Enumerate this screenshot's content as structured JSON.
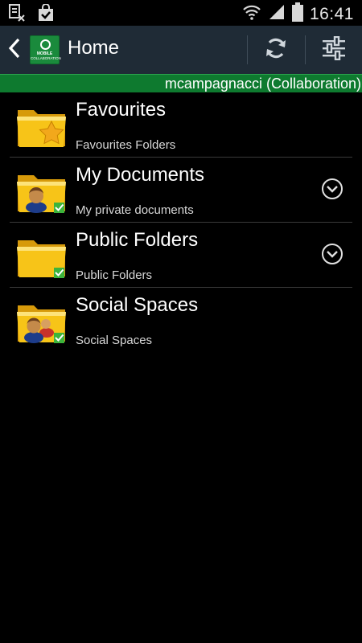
{
  "status_bar": {
    "time": "16:41",
    "icons": [
      "sim-error-icon",
      "shopping-bag-icon",
      "wifi-icon",
      "signal-icon",
      "battery-icon"
    ]
  },
  "action_bar": {
    "title": "Home",
    "logo_text_line1": "MOBILE",
    "logo_text_line2": "COLLABORATION",
    "back_icon": "chevron-left-icon",
    "refresh_icon": "refresh-icon",
    "settings_icon": "sliders-icon"
  },
  "user_banner": {
    "text": "mcampagnacci (Collaboration)"
  },
  "list": {
    "items": [
      {
        "title": "Favourites",
        "subtitle": "Favourites Folders",
        "icon": "folder-star-icon",
        "expandable": false
      },
      {
        "title": "My Documents",
        "subtitle": "My private documents",
        "icon": "folder-user-icon",
        "expandable": true
      },
      {
        "title": "Public Folders",
        "subtitle": "Public Folders",
        "icon": "folder-shared-icon",
        "expandable": true
      },
      {
        "title": "Social Spaces",
        "subtitle": "Social Spaces",
        "icon": "folder-group-icon",
        "expandable": false
      }
    ]
  },
  "colors": {
    "action_bar_bg": "#1f2b36",
    "banner_bg": "#0e7a2f",
    "folder_yellow": "#f7c418",
    "check_green": "#3cb43c"
  }
}
